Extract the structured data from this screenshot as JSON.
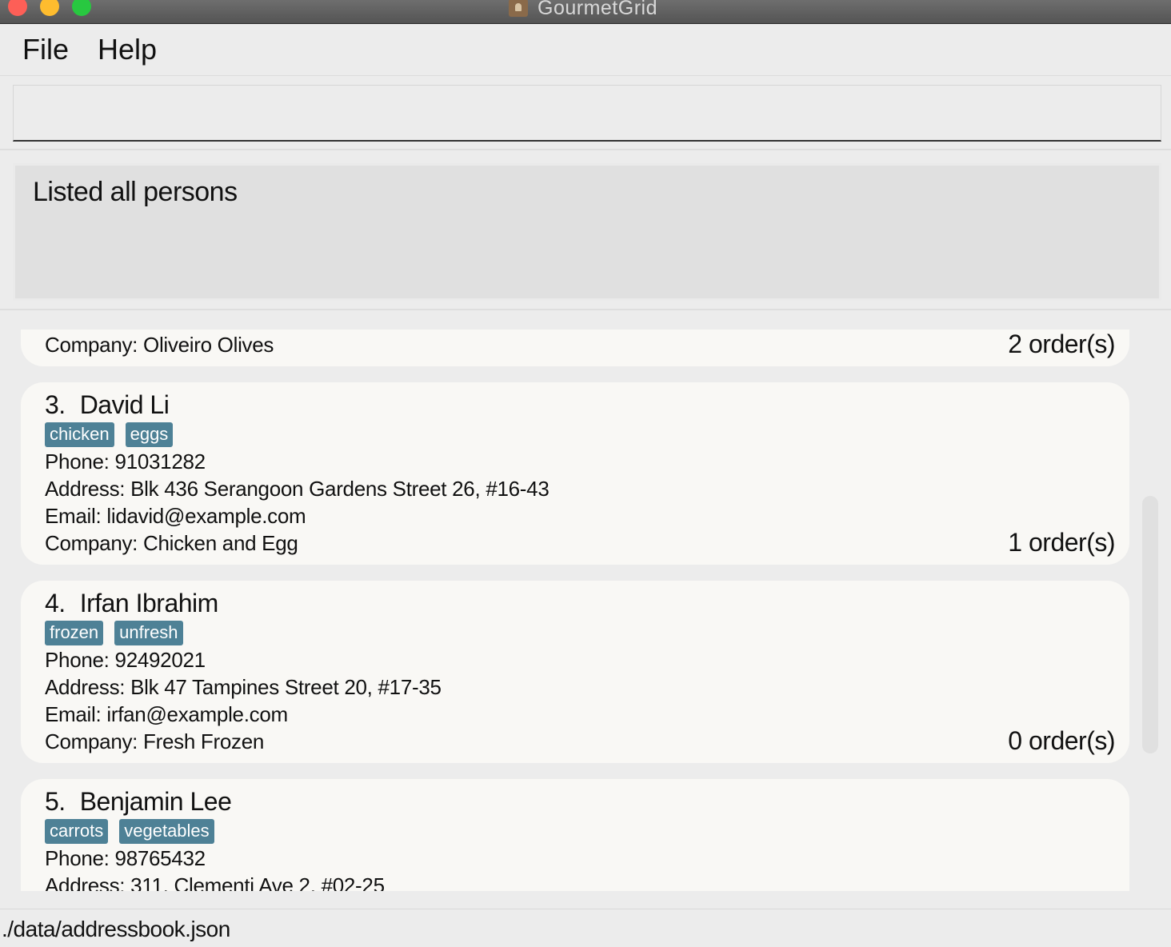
{
  "window": {
    "title": "GourmetGrid"
  },
  "menu": {
    "file": "File",
    "help": "Help"
  },
  "command": {
    "value": ""
  },
  "result": {
    "message": "Listed all persons"
  },
  "persons": [
    {
      "company": "Company: Oliveiro Olives",
      "orders": "2 order(s)"
    },
    {
      "index": "3.",
      "name": "David Li",
      "tags": [
        "chicken",
        "eggs"
      ],
      "phone": "Phone: 91031282",
      "address": "Address: Blk 436 Serangoon Gardens Street 26, #16-43",
      "email": "Email: lidavid@example.com",
      "company": "Company: Chicken and Egg",
      "orders": "1 order(s)"
    },
    {
      "index": "4.",
      "name": "Irfan Ibrahim",
      "tags": [
        "frozen",
        "unfresh"
      ],
      "phone": "Phone: 92492021",
      "address": "Address: Blk 47 Tampines Street 20, #17-35",
      "email": "Email: irfan@example.com",
      "company": "Company: Fresh Frozen",
      "orders": "0 order(s)"
    },
    {
      "index": "5.",
      "name": "Benjamin Lee",
      "tags": [
        "carrots",
        "vegetables"
      ],
      "phone": "Phone: 98765432",
      "address": "Address: 311, Clementi Ave 2, #02-25"
    }
  ],
  "status": {
    "file_path": "./data/addressbook.json"
  },
  "colors": {
    "tag_bg": "#4e8196",
    "card_bg": "#f9f8f5",
    "window_bg": "#ececec"
  }
}
